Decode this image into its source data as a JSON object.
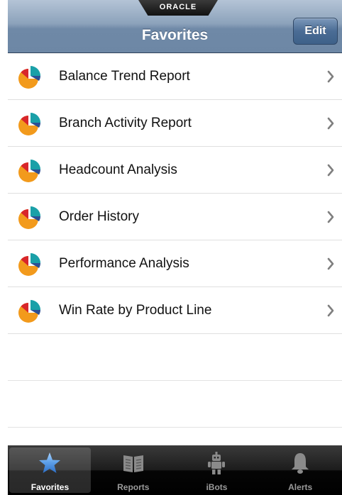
{
  "navbar": {
    "brand": "ORACLE",
    "title": "Favorites",
    "edit_label": "Edit"
  },
  "icons": {
    "row_icon": "pie-chart-icon",
    "row_accessory": "chevron-right-icon"
  },
  "colors": {
    "pie_orange": "#f29a1c",
    "pie_red": "#d8262b",
    "pie_teal": "#1aa0a8",
    "pie_blue": "#2c4f94",
    "tab_selected_icon": "#5b9ee8"
  },
  "favorites": [
    {
      "label": "Balance Trend Report"
    },
    {
      "label": "Branch Activity Report"
    },
    {
      "label": "Headcount Analysis"
    },
    {
      "label": "Order History"
    },
    {
      "label": "Performance Analysis"
    },
    {
      "label": "Win Rate by Product Line"
    }
  ],
  "tabbar": {
    "tabs": [
      {
        "label": "Favorites",
        "icon": "star-icon",
        "selected": true
      },
      {
        "label": "Reports",
        "icon": "book-icon",
        "selected": false
      },
      {
        "label": "iBots",
        "icon": "robot-icon",
        "selected": false
      },
      {
        "label": "Alerts",
        "icon": "bell-icon",
        "selected": false
      }
    ]
  }
}
